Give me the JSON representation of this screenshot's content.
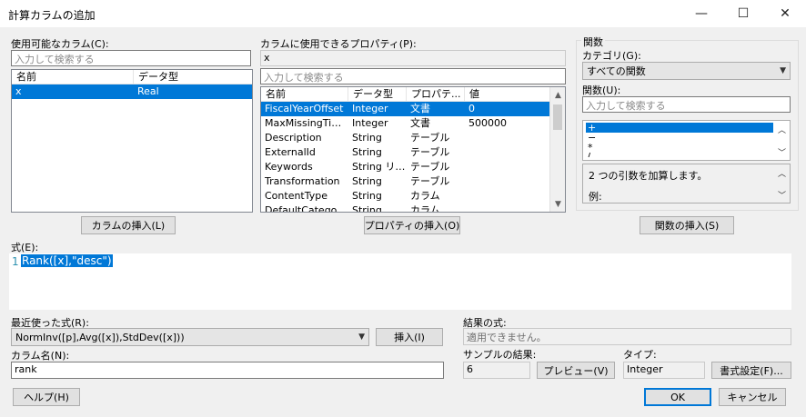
{
  "window": {
    "title": "計算カラムの追加",
    "minimize": "—",
    "maximize": "☐",
    "close": "✕"
  },
  "columns": {
    "label": "使用可能なカラム(C):",
    "search_placeholder": "入力して検索する",
    "headers": [
      "名前",
      "データ型"
    ],
    "rows": [
      {
        "name": "x",
        "type": "Real"
      }
    ],
    "insert_button": "カラムの挿入(L)"
  },
  "properties": {
    "label": "カラムに使用できるプロパティ(P):",
    "column_value": "x",
    "search_placeholder": "入力して検索する",
    "headers": [
      "名前",
      "データ型",
      "プロパテ...",
      "値"
    ],
    "rows": [
      {
        "name": "FiscalYearOffset",
        "type": "Integer",
        "prop": "文書",
        "value": "0"
      },
      {
        "name": "MaxMissingTime...",
        "type": "Integer",
        "prop": "文書",
        "value": "500000"
      },
      {
        "name": "Description",
        "type": "String",
        "prop": "テーブル",
        "value": ""
      },
      {
        "name": "ExternalId",
        "type": "String",
        "prop": "テーブル",
        "value": ""
      },
      {
        "name": "Keywords",
        "type": "String リスト",
        "prop": "テーブル",
        "value": ""
      },
      {
        "name": "Transformation",
        "type": "String",
        "prop": "テーブル",
        "value": ""
      },
      {
        "name": "ContentType",
        "type": "String",
        "prop": "カラム",
        "value": ""
      },
      {
        "name": "DefaultCategori...",
        "type": "String",
        "prop": "カラム",
        "value": ""
      }
    ],
    "insert_button": "プロパティの挿入(O)"
  },
  "functions": {
    "group_label": "関数",
    "category_label": "カテゴリ(G):",
    "category_value": "すべての関数",
    "function_label": "関数(U):",
    "search_placeholder": "入力して検索する",
    "items": [
      "+",
      "−",
      "*",
      "/"
    ],
    "description": "2 つの引数を加算します。",
    "example_label": "例:",
    "insert_button": "関数の挿入(S)"
  },
  "expression": {
    "label": "式(E):",
    "line_number": "1",
    "text": "Rank([x],\"desc\")"
  },
  "recent": {
    "label": "最近使った式(R):",
    "value": "NormInv([p],Avg([x]),StdDev([x]))",
    "insert_button": "挿入(I)"
  },
  "column_name": {
    "label": "カラム名(N):",
    "value": "rank"
  },
  "result": {
    "label": "結果の式:",
    "value": "適用できません。",
    "sample_label": "サンプルの結果:",
    "sample_value": "6",
    "preview_button": "プレビュー(V)",
    "type_label": "タイプ:",
    "type_value": "Integer",
    "format_button": "書式設定(F)..."
  },
  "footer": {
    "help": "ヘルプ(H)",
    "ok": "OK",
    "cancel": "キャンセル"
  },
  "colors": {
    "selection": "#0078d7",
    "window_bg": "#f0f0f0"
  }
}
